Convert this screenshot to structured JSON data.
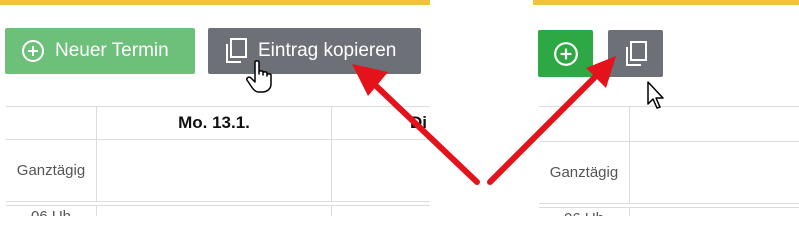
{
  "colors": {
    "accent_bar": "#f2c23c",
    "new_button_green_light": "#6dc07a",
    "new_button_green_dark": "#2ea844",
    "copy_button_gray": "#6e7078",
    "arrow_red": "#e3121b"
  },
  "left_panel": {
    "new_appointment_label": "Neuer Termin",
    "copy_entry_label": "Eintrag kopieren",
    "day_header_1": "Mo. 13.1.",
    "day_header_2": "Di",
    "allday_label": "Ganztägig",
    "hour_label": "06 Uh"
  },
  "right_panel": {
    "allday_label": "Ganztägig",
    "hour_label": "06 Uh"
  },
  "icons": {
    "plus": "plus-circle-icon",
    "copy": "copy-icon",
    "hand_cursor": "hand-pointer-icon",
    "arrow_cursor": "arrow-pointer-icon"
  }
}
